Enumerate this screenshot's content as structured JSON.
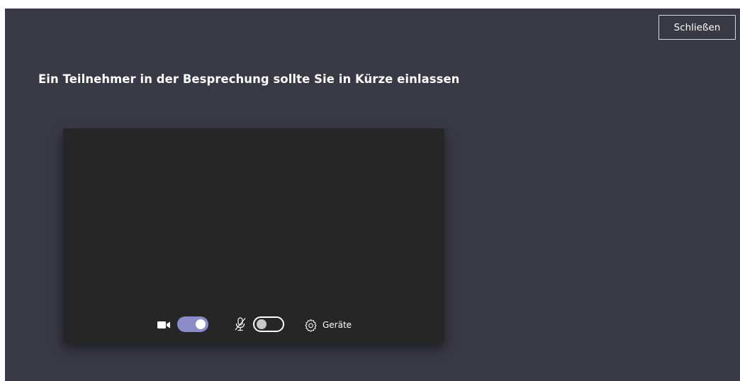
{
  "header": {
    "close_label": "Schließen"
  },
  "main": {
    "headline": "Ein Teilnehmer in der Besprechung sollte Sie in Kürze einlassen"
  },
  "controls": {
    "camera_toggle_on": true,
    "microphone_toggle_on": false,
    "devices_label": "Geräte"
  },
  "icons": {
    "camera": "video-camera-icon",
    "microphone": "microphone-off-icon",
    "devices": "gear-icon"
  },
  "colors": {
    "background": "#393845",
    "preview": "#262626",
    "toggle_on": "#8b8cc7",
    "text": "#ffffff"
  }
}
